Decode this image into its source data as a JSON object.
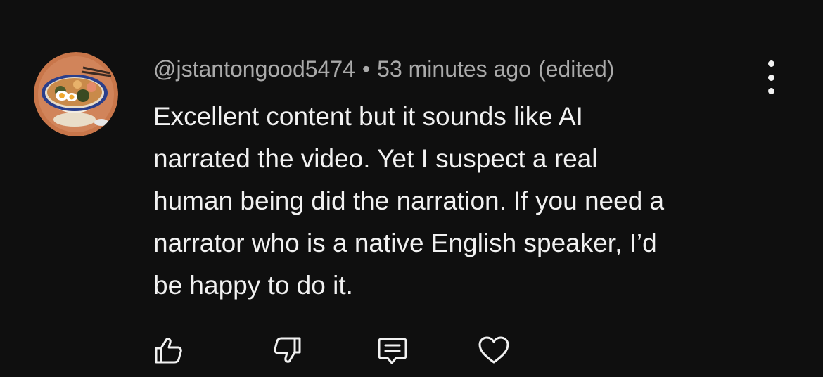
{
  "comment": {
    "author": "@jstantongood5474",
    "separator": "•",
    "timestamp": "53 minutes ago",
    "edited_label": "(edited)",
    "text_lines": [
      "Excellent content but it sounds like AI",
      "narrated the video. Yet I suspect a real",
      "human being did the narration. If you need a",
      "narrator who is a native English speaker, I’d",
      "be happy to do it."
    ],
    "avatar_icon": "ramen-bowl-avatar"
  },
  "actions": {
    "like_icon": "thumbs-up-icon",
    "dislike_icon": "thumbs-down-icon",
    "reply_icon": "comment-reply-icon",
    "heart_icon": "heart-icon",
    "more_icon": "more-vertical-icon"
  },
  "colors": {
    "background": "#0f0f0f",
    "text_primary": "#f1f1f1",
    "text_secondary": "#aaaaaa",
    "avatar_bg": "#c8764a"
  }
}
